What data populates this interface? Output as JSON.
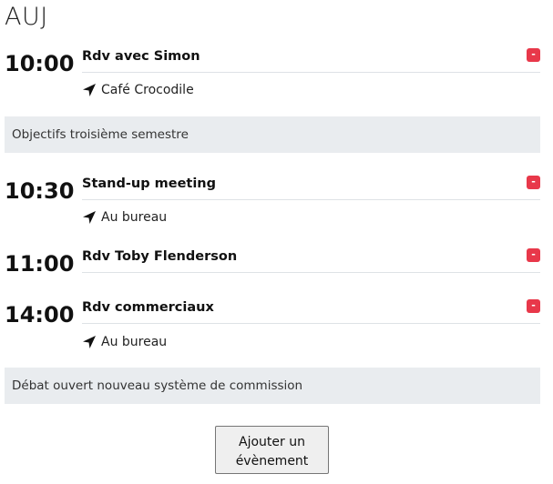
{
  "day_label": "AUJ",
  "events": [
    {
      "time": "10:00",
      "title": "Rdv avec Simon",
      "location": "Café Crocodile",
      "delete_label": "-"
    },
    {
      "time": "10:30",
      "title": "Stand-up meeting",
      "location": "Au bureau",
      "delete_label": "-"
    },
    {
      "time": "11:00",
      "title": "Rdv Toby Flenderson",
      "delete_label": "-"
    },
    {
      "time": "14:00",
      "title": "Rdv commerciaux",
      "location": "Au bureau",
      "delete_label": "-"
    }
  ],
  "notes": [
    "Objectifs troisième semestre",
    "Débat ouvert nouveau système de commission"
  ],
  "add_button_label_line1": "Ajouter un",
  "add_button_label_line2": "évènement",
  "colors": {
    "delete": "#e8384a",
    "note_bg": "#e9ecef"
  }
}
